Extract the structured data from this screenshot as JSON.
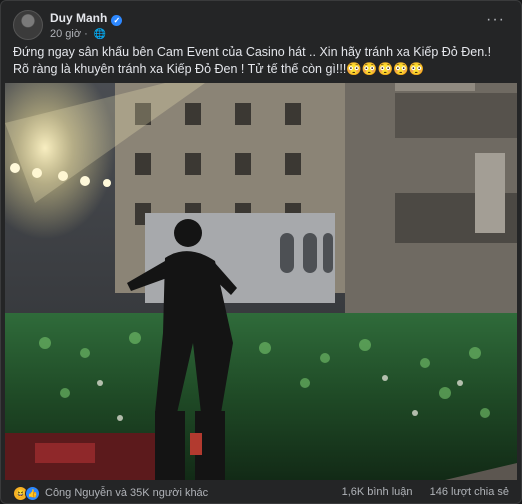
{
  "post": {
    "author": "Duy Manh",
    "time": "20 giờ",
    "text": "Đứng ngay sân khấu bên Cam Event của Casino hát .. Xin hãy tránh xa Kiếp Đỏ Đen.! Rõ ràng là khuyên tránh xa Kiếp Đỏ Đen ! Tử tế thế còn gì!!!😳😳😳😳😳"
  },
  "icons": {
    "verified": "verified-badge-icon",
    "audience": "globe-icon",
    "menu": "more-options-icon",
    "reaction_1": "haha-icon",
    "reaction_2": "like-icon"
  },
  "footer": {
    "reactions_text": "Công Nguyễn và 35K người khác",
    "comments": "1,6K bình luận",
    "shares": "146 lượt chia sẻ"
  },
  "colors": {
    "background": "#18191a",
    "card": "#242526",
    "text": "#e4e6eb",
    "secondary": "#b0b3b8",
    "accent": "#2d88ff"
  }
}
